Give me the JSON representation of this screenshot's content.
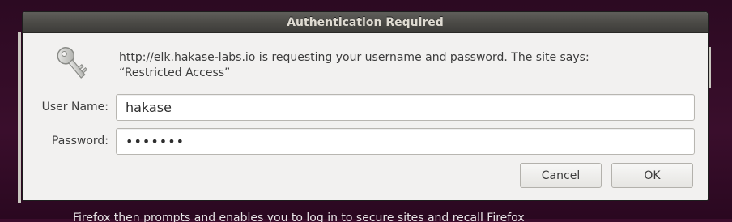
{
  "dialog": {
    "title": "Authentication Required",
    "message_line1": "http://elk.hakase-labs.io is requesting your username and password. The site says:",
    "message_line2": "“Restricted Access”",
    "key_icon": "key-icon"
  },
  "fields": {
    "username_label": "User Name:",
    "username_value": "hakase",
    "password_label": "Password:",
    "password_value": "•••••••"
  },
  "buttons": {
    "cancel_label": "Cancel",
    "ok_label": "OK"
  },
  "background": {
    "partial_text": "Firefox then prompts and enables you to log in to secure sites and recall Firefox"
  },
  "colors": {
    "desktop": "#3b0d2c",
    "dialog_bg": "#f2f1f0",
    "titlebar": "#4a4945",
    "title_text": "#dfdbd2"
  }
}
